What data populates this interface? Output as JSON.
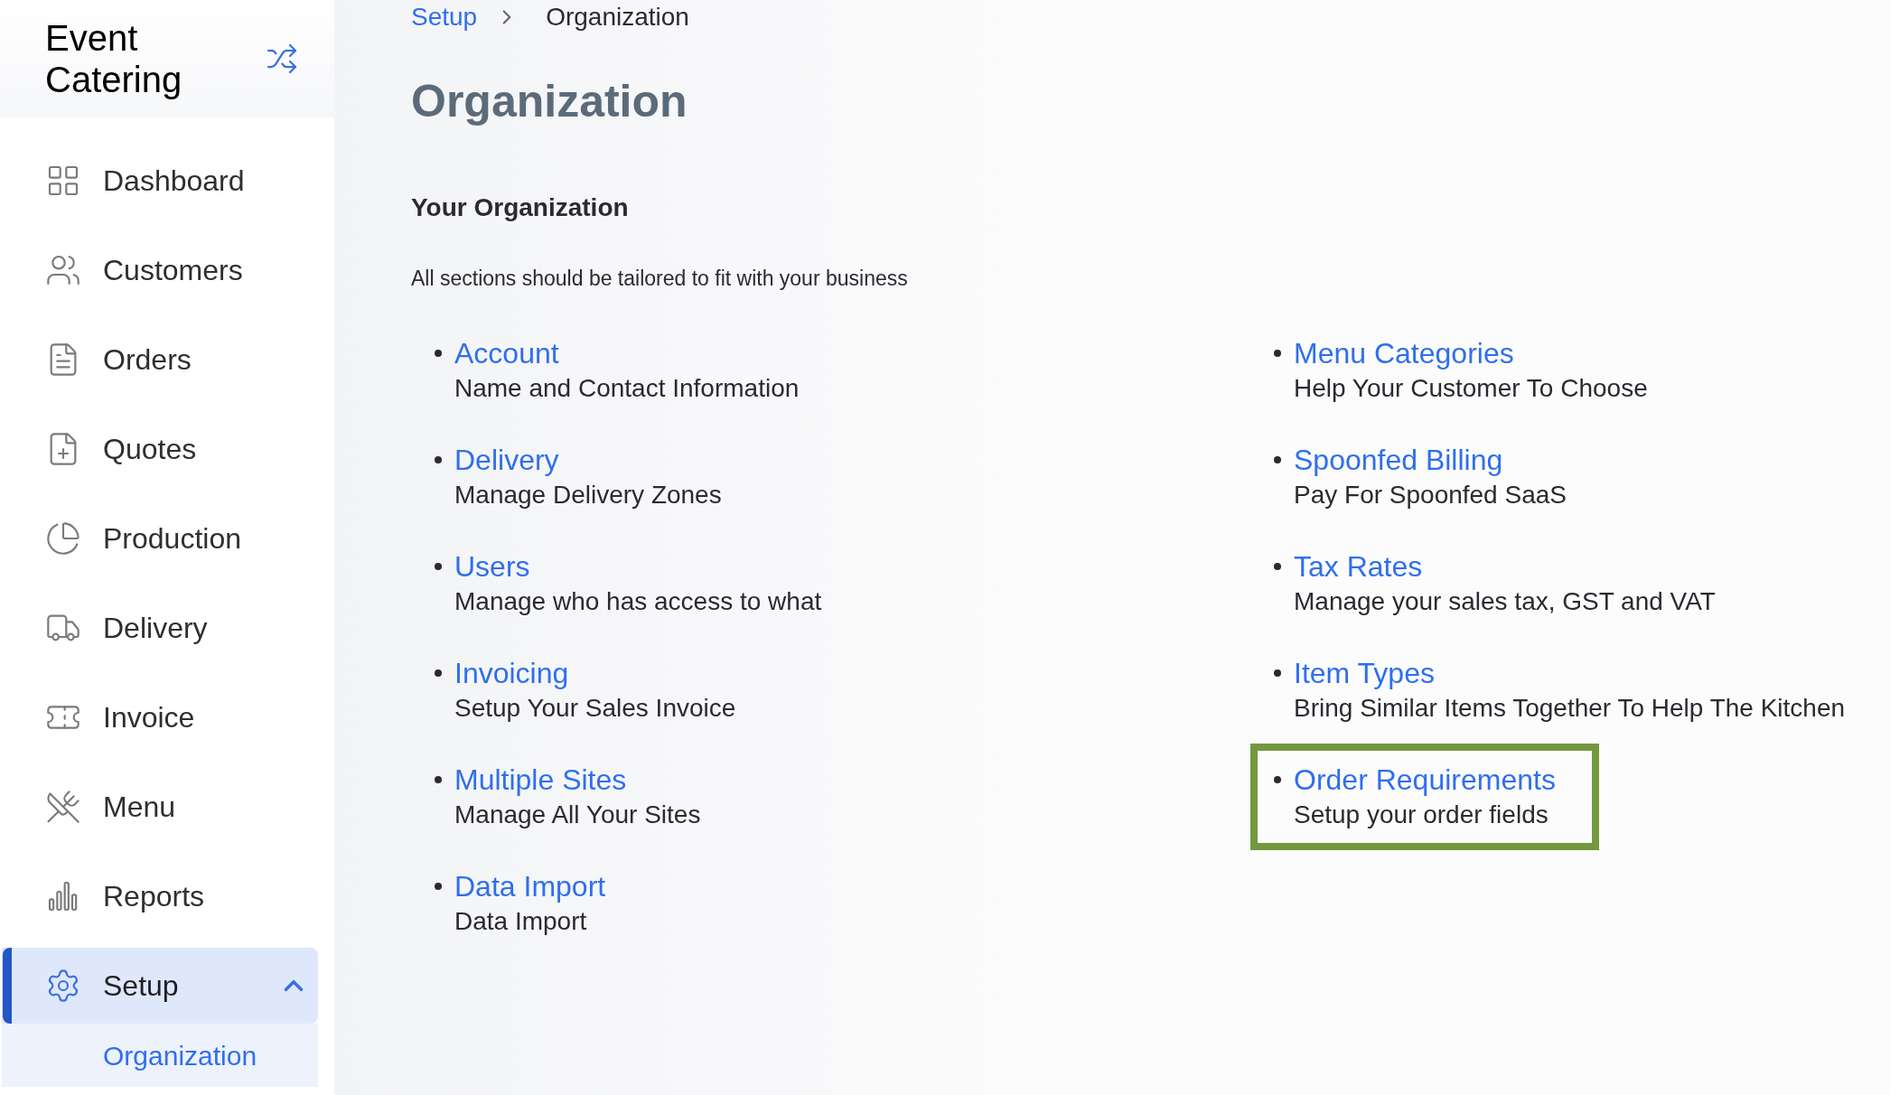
{
  "sidebar": {
    "brand": "Event Catering",
    "items": [
      {
        "label": "Dashboard",
        "selected": false
      },
      {
        "label": "Customers",
        "selected": false
      },
      {
        "label": "Orders",
        "selected": false
      },
      {
        "label": "Quotes",
        "selected": false
      },
      {
        "label": "Production",
        "selected": false
      },
      {
        "label": "Delivery",
        "selected": false
      },
      {
        "label": "Invoice",
        "selected": false
      },
      {
        "label": "Menu",
        "selected": false
      },
      {
        "label": "Reports",
        "selected": false
      },
      {
        "label": "Setup",
        "selected": true,
        "expanded": true,
        "children": [
          {
            "label": "Organization",
            "selected": true
          }
        ]
      }
    ]
  },
  "breadcrumb": [
    "Setup",
    "Organization"
  ],
  "page_title": "Organization",
  "section_title": "Your Organization",
  "section_description": "All sections should be tailored to fit with your business",
  "columns": [
    [
      {
        "title": "Account",
        "description": "Name and Contact Information",
        "highlighted": false
      },
      {
        "title": "Delivery",
        "description": "Manage Delivery Zones",
        "highlighted": false
      },
      {
        "title": "Users",
        "description": "Manage who has access to what",
        "highlighted": false
      },
      {
        "title": "Invoicing",
        "description": "Setup Your Sales Invoice",
        "highlighted": false
      },
      {
        "title": "Multiple Sites",
        "description": "Manage All Your Sites",
        "highlighted": false
      },
      {
        "title": "Data Import",
        "description": "Data Import",
        "highlighted": false
      }
    ],
    [
      {
        "title": "Menu Categories",
        "description": "Help Your Customer To Choose",
        "highlighted": false
      },
      {
        "title": "Spoonfed Billing",
        "description": "Pay For Spoonfed SaaS",
        "highlighted": false
      },
      {
        "title": "Tax Rates",
        "description": "Manage your sales tax, GST and VAT",
        "highlighted": false
      },
      {
        "title": "Item Types",
        "description": "Bring Similar Items Together To Help The Kitchen",
        "highlighted": false
      },
      {
        "title": "Order Requirements",
        "description": "Setup your order fields",
        "highlighted": true
      }
    ]
  ]
}
